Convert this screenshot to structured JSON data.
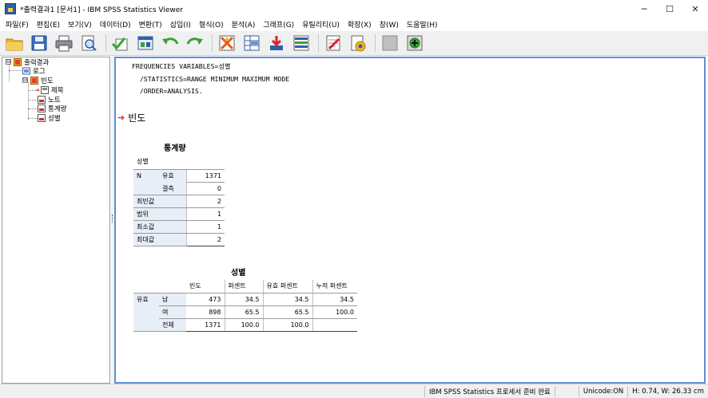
{
  "window": {
    "title": "*출력결과1 [문서1] - IBM SPSS Statistics Viewer",
    "controls": {
      "minimize": "─",
      "maximize": "☐",
      "close": "✕"
    }
  },
  "menu": [
    "파일(F)",
    "편집(E)",
    "보기(V)",
    "데이터(D)",
    "변환(T)",
    "삽입(I)",
    "형식(O)",
    "분석(A)",
    "그래프(G)",
    "유틸리티(U)",
    "확장(X)",
    "창(W)",
    "도움말(H)"
  ],
  "toolbar": {
    "icons": [
      "open-folder-icon",
      "save-icon",
      "print-icon",
      "print-preview-icon",
      "export-icon",
      "recall-dialog-icon",
      "undo-icon",
      "redo-icon",
      "goto-data-icon",
      "goto-case-icon",
      "goto-variable-icon",
      "variables-icon",
      "designate-window-icon",
      "show-hide-icon",
      "collapse-icon",
      "insert-output-icon"
    ]
  },
  "outline": {
    "nodes": [
      {
        "label": "출력결과",
        "expander": "⊟"
      },
      {
        "label": "로그"
      },
      {
        "label": "빈도",
        "expander": "⊟"
      },
      {
        "label": "제목"
      },
      {
        "label": "노트"
      },
      {
        "label": "통계량"
      },
      {
        "label": "성별"
      }
    ]
  },
  "syntax": {
    "line1": "FREQUENCIES VARIABLES=성별",
    "line2": "  /STATISTICS=RANGE MINIMUM MAXIMUM MODE",
    "line3": "  /ORDER=ANALYSIS."
  },
  "section_title": "빈도",
  "stats_table": {
    "title": "통계량",
    "variable": "성별",
    "rows": [
      {
        "label": "N",
        "sub": "유효",
        "value": "1371"
      },
      {
        "label": "",
        "sub": "결측",
        "value": "0"
      },
      {
        "label": "최빈값",
        "sub": "",
        "value": "2"
      },
      {
        "label": "범위",
        "sub": "",
        "value": "1"
      },
      {
        "label": "최소값",
        "sub": "",
        "value": "1"
      },
      {
        "label": "최대값",
        "sub": "",
        "value": "2"
      }
    ]
  },
  "freq_table": {
    "title": "성별",
    "headers": [
      "빈도",
      "퍼센트",
      "유효 퍼센트",
      "누적 퍼센트"
    ],
    "group": "유효",
    "rows": [
      {
        "label": "남",
        "freq": "473",
        "pct": "34.5",
        "vpct": "34.5",
        "cpct": "34.5"
      },
      {
        "label": "여",
        "freq": "898",
        "pct": "65.5",
        "vpct": "65.5",
        "cpct": "100.0"
      },
      {
        "label": "전체",
        "freq": "1371",
        "pct": "100.0",
        "vpct": "100.0",
        "cpct": ""
      }
    ]
  },
  "status": {
    "processor": "IBM SPSS Statistics 프로세서 준비 완료",
    "unicode": "Unicode:ON",
    "size": "H: 0.74, W: 26.33 cm"
  },
  "colors": {
    "accent": "#5f8fd6",
    "label_bg": "#e8eef7",
    "arrow": "#e0202a"
  }
}
